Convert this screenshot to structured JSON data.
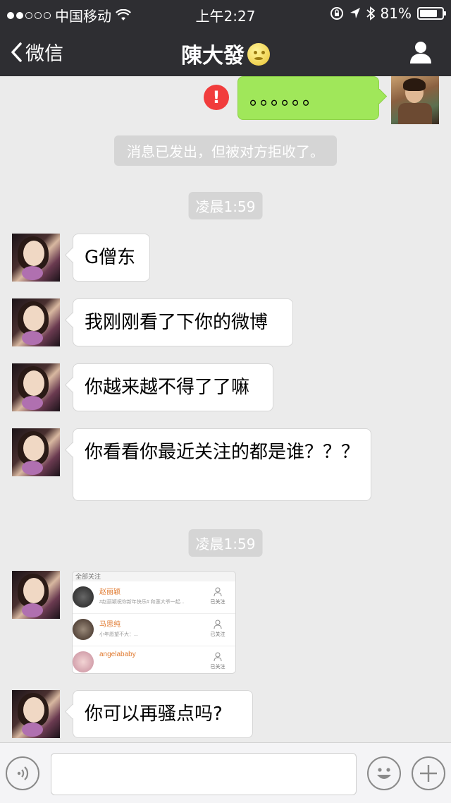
{
  "status_bar": {
    "carrier": "中国移动",
    "time": "上午2:27",
    "battery": "81%",
    "battery_level": 0.81
  },
  "nav": {
    "back_label": "微信",
    "title": "陳大發"
  },
  "messages": {
    "sent_text": "。。。。。。",
    "rejected_notice": "消息已发出，但被对方拒收了。",
    "time1": "凌晨1:59",
    "m1": "G僧东",
    "m2": "我刚刚看了下你的微博",
    "m3": "你越来越不得了了嘛",
    "m4": "你看看你最近关注的都是谁？？？",
    "time2": "凌晨1:59",
    "m5": "你可以再骚点吗?"
  },
  "screenshot_card": {
    "header": "全部关注",
    "follow_label": "已关注",
    "rows": [
      {
        "name": "赵丽颖",
        "desc": "#赵丽颖祝你新年快乐# 和莲大爷一起..."
      },
      {
        "name": "马思纯",
        "desc": "小年愿望不大：..."
      },
      {
        "name": "angelababy",
        "desc": ""
      }
    ]
  },
  "colors": {
    "bar": "#2e2e32",
    "background": "#ebebeb",
    "sent_bubble": "#a0e75a",
    "error": "#f13c3c"
  },
  "icons": {
    "back": "chevron-left-icon",
    "profile": "person-icon",
    "voice": "voice-icon",
    "emoji": "emoji-icon",
    "more": "plus-icon",
    "error": "exclamation-icon"
  }
}
